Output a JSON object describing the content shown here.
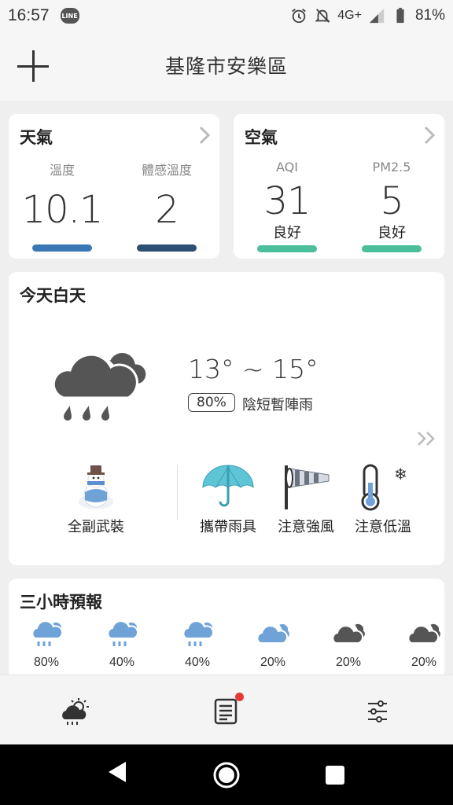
{
  "status": {
    "time": "16:57",
    "line_badge": "LINE",
    "network": "4G+",
    "battery": "81%"
  },
  "header": {
    "location": "基隆市安樂區",
    "add_icon": "plus-icon"
  },
  "weather_card": {
    "title": "天氣",
    "temp_label": "溫度",
    "temp_value": "10.1",
    "feels_label": "體感溫度",
    "feels_value": "2",
    "temp_bar_color": "#3a78b5",
    "feels_bar_color": "#2c4f73"
  },
  "air_card": {
    "title": "空氣",
    "aqi_label": "AQI",
    "aqi_value": "31",
    "aqi_status": "良好",
    "pm_label": "PM2.5",
    "pm_value": "5",
    "pm_status": "良好",
    "bar_color": "#4bbf9b"
  },
  "today_card": {
    "title": "今天白天",
    "temp_range": "13° ~ 15°",
    "pop": "80%",
    "description": "陰短暫陣雨",
    "icon": "cloud-rain-icon",
    "tips": [
      {
        "label": "全副武裝",
        "icon": "snowman-icon"
      },
      {
        "label": "攜帶雨具",
        "icon": "umbrella-icon"
      },
      {
        "label": "注意強風",
        "icon": "windsock-icon"
      },
      {
        "label": "注意低溫",
        "icon": "thermometer-cold-icon"
      }
    ]
  },
  "hourly_card": {
    "title": "三小時預報",
    "items": [
      {
        "pop": "80%",
        "icon": "rain-cloud-icon"
      },
      {
        "pop": "40%",
        "icon": "rain-cloud-icon"
      },
      {
        "pop": "40%",
        "icon": "rain-cloud-icon"
      },
      {
        "pop": "20%",
        "icon": "cloud-icon"
      },
      {
        "pop": "20%",
        "icon": "dark-cloud-icon"
      },
      {
        "pop": "20%",
        "icon": "dark-cloud-icon"
      }
    ]
  },
  "bottom_nav": {
    "items": [
      "weather-nav-icon",
      "news-nav-icon",
      "settings-nav-icon"
    ]
  }
}
